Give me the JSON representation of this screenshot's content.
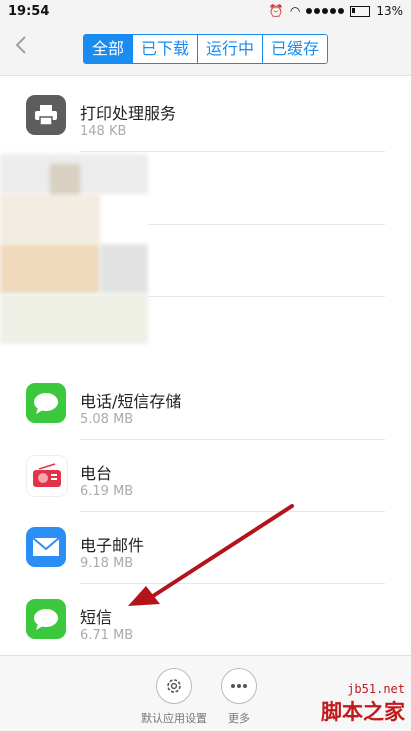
{
  "status_bar": {
    "time": "19:54",
    "battery": "13%"
  },
  "header": {
    "tabs": [
      {
        "label": "全部",
        "active": true
      },
      {
        "label": "已下载",
        "active": false
      },
      {
        "label": "运行中",
        "active": false
      },
      {
        "label": "已缓存",
        "active": false
      }
    ]
  },
  "apps": [
    {
      "name": "打印处理服务",
      "size": "148 KB",
      "icon": "printer-icon"
    },
    {
      "name": "电话/短信存储",
      "size": "5.08 MB",
      "icon": "message-bubble-icon"
    },
    {
      "name": "电台",
      "size": "6.19 MB",
      "icon": "radio-icon"
    },
    {
      "name": "电子邮件",
      "size": "9.18 MB",
      "icon": "mail-icon"
    },
    {
      "name": "短信",
      "size": "6.71 MB",
      "icon": "message-bubble-icon"
    }
  ],
  "bottom_bar": {
    "default_settings_label": "默认应用设置",
    "more_label": "更多"
  },
  "watermark": {
    "line1": "jb51.net",
    "line2": "脚本之家"
  },
  "colors": {
    "accent": "#1a8cf0",
    "arrow": "#b3141b",
    "green": "#4cd137"
  }
}
